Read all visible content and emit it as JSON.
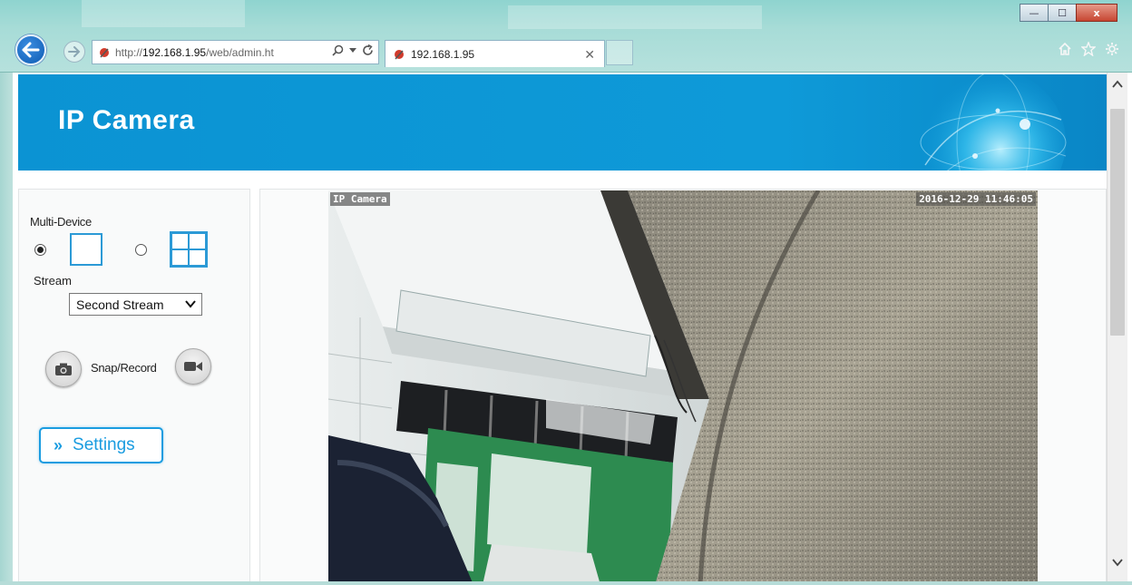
{
  "browser": {
    "address_prefix": "http://",
    "address_host": "192.168.1.95",
    "address_path": "/web/admin.ht",
    "tab_title": "192.168.1.95",
    "window_buttons": {
      "minimize": "—",
      "maximize": "☐",
      "close": "x"
    }
  },
  "header": {
    "title": "IP Camera"
  },
  "sidebar": {
    "multi_device_label": "Multi-Device",
    "layout_options": [
      {
        "name": "single",
        "selected": true
      },
      {
        "name": "quad",
        "selected": false
      }
    ],
    "stream_label": "Stream",
    "stream_selected": "Second Stream",
    "snap_record_label": "Snap/Record",
    "settings_chevron": "»",
    "settings_label": "Settings"
  },
  "video": {
    "overlay_name": "IP Camera",
    "overlay_timestamp": "2016-12-29 11:46:05"
  },
  "colors": {
    "banner": "#0e9ad8",
    "accent": "#1a9ce0"
  }
}
